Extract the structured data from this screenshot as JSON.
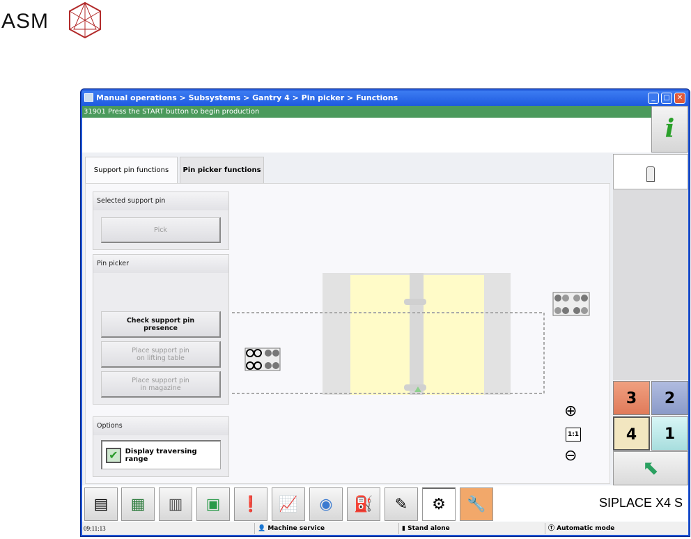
{
  "logo": {
    "text": "ASM",
    "color": "#b22a2a"
  },
  "window": {
    "breadcrumb": "Manual operations > Subsystems > Gantry 4 > Pin picker > Functions",
    "controls": [
      "minimize",
      "maximize",
      "close"
    ]
  },
  "message": {
    "text": "31901 Press the START button to begin production",
    "color": "#4b9a5c"
  },
  "info_button": {
    "icon": "info-icon",
    "label": "i"
  },
  "tabs": [
    {
      "label": "Support pin functions",
      "active": true
    },
    {
      "label": "Pin picker functions",
      "active": false
    }
  ],
  "groups": {
    "selected": {
      "title": "Selected support pin",
      "pick": "Pick"
    },
    "picker": {
      "title": "Pin picker",
      "check_line1": "Check support pin",
      "check_line2": "presence",
      "place_table_line1": "Place support pin",
      "place_table_line2": "on lifting table",
      "place_mag_line1": "Place support pin",
      "place_mag_line2": "in magazine"
    },
    "options": {
      "title": "Options",
      "display_range": "Display traversing range",
      "display_range_checked": true
    }
  },
  "zoom": {
    "in": "zoom-in-icon",
    "reset": "1:1",
    "out": "zoom-out-icon"
  },
  "gantries": [
    {
      "label": "3",
      "color": "#e88a66"
    },
    {
      "label": "2",
      "color": "#9aaad0"
    },
    {
      "label": "4",
      "color": "#f2e6c0",
      "selected": true
    },
    {
      "label": "1",
      "color": "#bfeaea"
    }
  ],
  "toolbar": {
    "icons": [
      "production-icon",
      "setup-icon",
      "feeder-icon",
      "board-icon",
      "alarm-icon",
      "statistics-icon",
      "vision-icon",
      "maintenance-oil-icon",
      "tools-icon",
      "manual-operations-icon",
      "service-wrench-icon"
    ],
    "machine": "SIPLACE X4 S"
  },
  "status": {
    "time": "09:11:13",
    "user": "Machine service",
    "mode_line": "Stand alone",
    "operation": "Automatic mode"
  }
}
